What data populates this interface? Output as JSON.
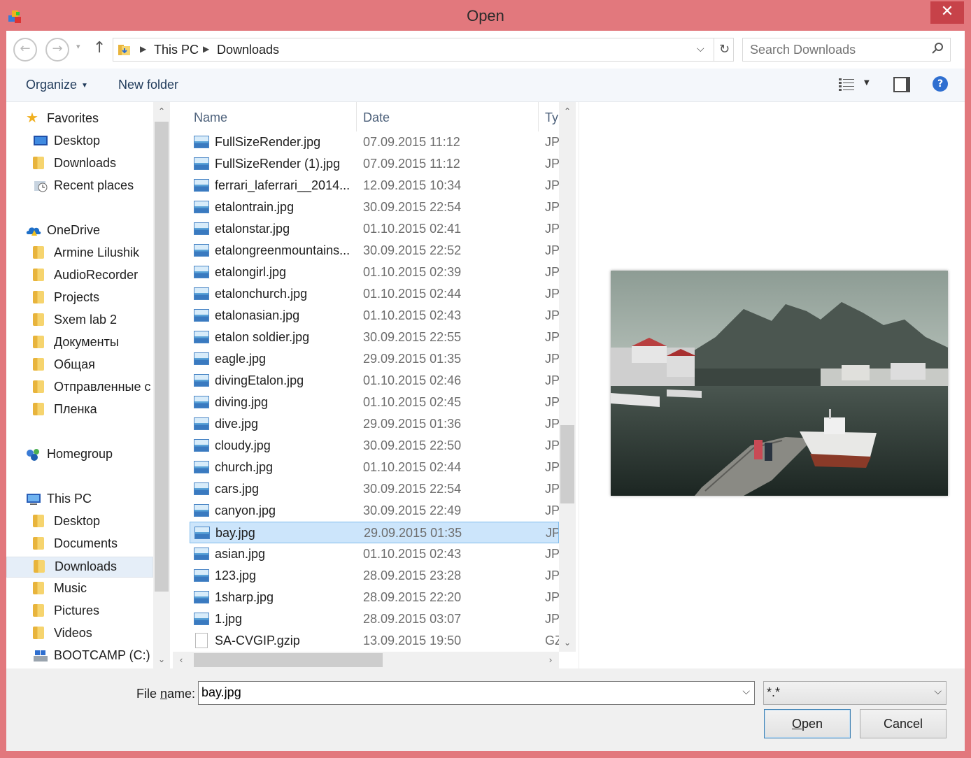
{
  "window": {
    "title": "Open",
    "close_glyph": "✕"
  },
  "nav": {
    "back_glyph": "←",
    "forward_glyph": "→",
    "dropdown_glyph": "▾",
    "up_glyph": "↑",
    "breadcrumbs": [
      "This PC",
      "Downloads"
    ],
    "refresh_glyph": "↻",
    "search_placeholder": "Search Downloads"
  },
  "toolbar": {
    "organize_label": "Organize",
    "new_folder_label": "New folder",
    "help_glyph": "?"
  },
  "sidebar": {
    "items": [
      {
        "label": "Favorites",
        "icon": "star-icon",
        "level": 0
      },
      {
        "label": "Desktop",
        "icon": "desktop-icon",
        "level": 1
      },
      {
        "label": "Downloads",
        "icon": "downloads-folder-icon",
        "level": 1
      },
      {
        "label": "Recent places",
        "icon": "recent-places-icon",
        "level": 1
      },
      {
        "label": "OneDrive",
        "icon": "onedrive-icon",
        "level": 0
      },
      {
        "label": "Armine Lilushik",
        "icon": "folder-icon",
        "level": 1
      },
      {
        "label": "AudioRecorder",
        "icon": "folder-icon",
        "level": 1
      },
      {
        "label": "Projects",
        "icon": "folder-icon",
        "level": 1
      },
      {
        "label": "Sxem lab 2",
        "icon": "folder-icon",
        "level": 1
      },
      {
        "label": "Документы",
        "icon": "folder-icon",
        "level": 1
      },
      {
        "label": "Общая",
        "icon": "folder-icon",
        "level": 1
      },
      {
        "label": "Отправленные с",
        "icon": "folder-icon",
        "level": 1
      },
      {
        "label": "Пленка",
        "icon": "folder-icon",
        "level": 1
      },
      {
        "label": "Homegroup",
        "icon": "homegroup-icon",
        "level": 0
      },
      {
        "label": "This PC",
        "icon": "computer-icon",
        "level": 0
      },
      {
        "label": "Desktop",
        "icon": "desktop-folder-icon",
        "level": 1
      },
      {
        "label": "Documents",
        "icon": "documents-folder-icon",
        "level": 1
      },
      {
        "label": "Downloads",
        "icon": "downloads-folder-icon",
        "level": 1,
        "selected": true
      },
      {
        "label": "Music",
        "icon": "music-folder-icon",
        "level": 1
      },
      {
        "label": "Pictures",
        "icon": "pictures-folder-icon",
        "level": 1
      },
      {
        "label": "Videos",
        "icon": "videos-folder-icon",
        "level": 1
      },
      {
        "label": "BOOTCAMP (C:)",
        "icon": "drive-icon",
        "level": 1
      }
    ]
  },
  "filelist": {
    "columns": [
      "Name",
      "Date",
      "Ty"
    ],
    "rows": [
      {
        "name": "FullSizeRender.jpg",
        "date": "07.09.2015 11:12",
        "type": "JPE"
      },
      {
        "name": "FullSizeRender (1).jpg",
        "date": "07.09.2015 11:12",
        "type": "JPE"
      },
      {
        "name": "ferrari_laferrari__2014...",
        "date": "12.09.2015 10:34",
        "type": "JPE"
      },
      {
        "name": "etalontrain.jpg",
        "date": "30.09.2015 22:54",
        "type": "JPE"
      },
      {
        "name": "etalonstar.jpg",
        "date": "01.10.2015 02:41",
        "type": "JPE"
      },
      {
        "name": "etalongreenmountains...",
        "date": "30.09.2015 22:52",
        "type": "JPE"
      },
      {
        "name": "etalongirl.jpg",
        "date": "01.10.2015 02:39",
        "type": "JPE"
      },
      {
        "name": "etalonchurch.jpg",
        "date": "01.10.2015 02:44",
        "type": "JPE"
      },
      {
        "name": "etalonasian.jpg",
        "date": "01.10.2015 02:43",
        "type": "JPE"
      },
      {
        "name": "etalon soldier.jpg",
        "date": "30.09.2015 22:55",
        "type": "JPE"
      },
      {
        "name": "eagle.jpg",
        "date": "29.09.2015 01:35",
        "type": "JPE"
      },
      {
        "name": "divingEtalon.jpg",
        "date": "01.10.2015 02:46",
        "type": "JPE"
      },
      {
        "name": "diving.jpg",
        "date": "01.10.2015 02:45",
        "type": "JPE"
      },
      {
        "name": "dive.jpg",
        "date": "29.09.2015 01:36",
        "type": "JPE"
      },
      {
        "name": "cloudy.jpg",
        "date": "30.09.2015 22:50",
        "type": "JPE"
      },
      {
        "name": "church.jpg",
        "date": "01.10.2015 02:44",
        "type": "JPE"
      },
      {
        "name": "cars.jpg",
        "date": "30.09.2015 22:54",
        "type": "JPE"
      },
      {
        "name": "canyon.jpg",
        "date": "30.09.2015 22:49",
        "type": "JPE"
      },
      {
        "name": "bay.jpg",
        "date": "29.09.2015 01:35",
        "type": "JPE",
        "selected": true
      },
      {
        "name": "asian.jpg",
        "date": "01.10.2015 02:43",
        "type": "JPE"
      },
      {
        "name": "123.jpg",
        "date": "28.09.2015 23:28",
        "type": "JPE"
      },
      {
        "name": "1sharp.jpg",
        "date": "28.09.2015 22:20",
        "type": "JPE"
      },
      {
        "name": "1.jpg",
        "date": "28.09.2015 03:07",
        "type": "JPE"
      },
      {
        "name": "SA-CVGIP.gzip",
        "date": "13.09.2015 19:50",
        "type": "GZ",
        "doc": true
      }
    ]
  },
  "footer": {
    "filename_label_pre": "File ",
    "filename_label_accel": "n",
    "filename_label_post": "ame:",
    "filename_value": "bay.jpg",
    "filetype_value": "*.*",
    "open_accel": "O",
    "open_rest": "pen",
    "cancel_label": "Cancel"
  },
  "colors": {
    "frame": "#e2787d",
    "close": "#c74249",
    "selection": "#cce5fb"
  }
}
